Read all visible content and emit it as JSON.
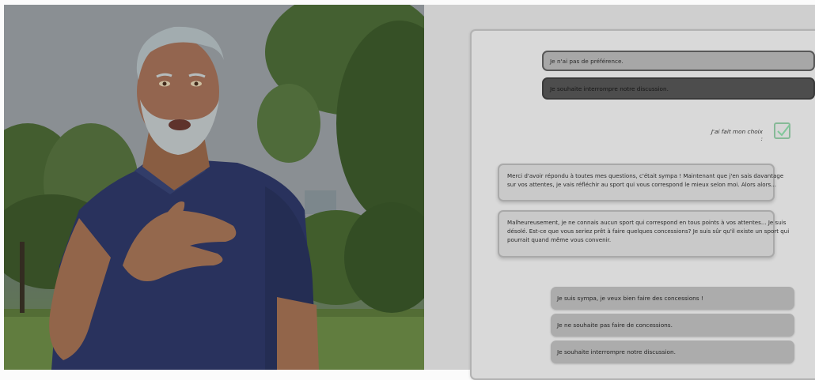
{
  "scene": {
    "character": "elderly-man-avatar",
    "setting": "park-trees-background"
  },
  "chat": {
    "top_options": [
      "Je n'ai pas de préférence.",
      "Je souhaite interrompre notre discussion."
    ],
    "choice_label": "J'ai fait mon choix :",
    "messages": [
      {
        "lines": [
          "Merci d'avoir répondu à toutes mes questions, c'était sympa ! Maintenant que j'en sais davantage",
          "sur vos attentes, je vais réfléchir au sport qui vous correspond le mieux selon moi. Alors alors..."
        ]
      },
      {
        "lines": [
          "Malheureusement, je ne connais aucun sport qui correspond en tous points à vos attentes... Je suis",
          "désolé. Est-ce que vous seriez prêt à faire quelques concessions? Je suis sûr qu'il existe un sport qui",
          "pourrait quand même vous convenir."
        ]
      }
    ],
    "reply_options": [
      "Je suis sympa, je veux bien faire des concessions !",
      "Je ne souhaite pas faire de concessions.",
      "Je souhaite interrompre notre discussion."
    ]
  },
  "colors": {
    "checkbox_border": "#86b997",
    "checkmark": "#7fc79a",
    "panel": "#d9d9d9",
    "shirt": "#2f3a6a"
  }
}
